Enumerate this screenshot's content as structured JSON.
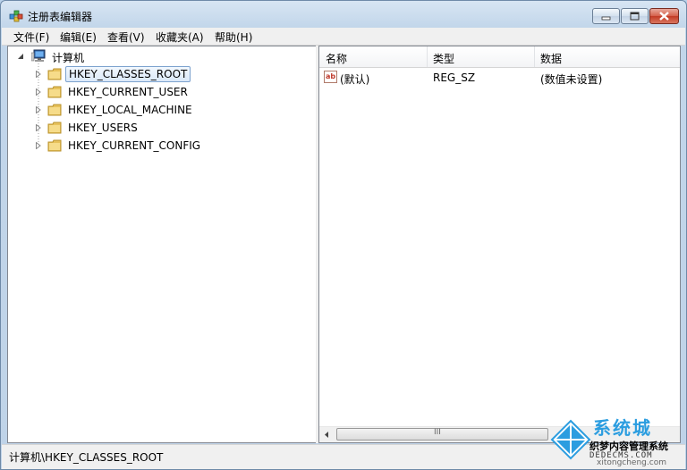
{
  "window": {
    "title": "注册表编辑器"
  },
  "menu": [
    {
      "label": "文件(F)"
    },
    {
      "label": "编辑(E)"
    },
    {
      "label": "查看(V)"
    },
    {
      "label": "收藏夹(A)"
    },
    {
      "label": "帮助(H)"
    }
  ],
  "tree": {
    "root_label": "计算机",
    "root_icon": "computer-icon",
    "folder_icon": "folder-icon",
    "nodes": [
      {
        "label": "HKEY_CLASSES_ROOT",
        "selected": true
      },
      {
        "label": "HKEY_CURRENT_USER"
      },
      {
        "label": "HKEY_LOCAL_MACHINE"
      },
      {
        "label": "HKEY_USERS"
      },
      {
        "label": "HKEY_CURRENT_CONFIG"
      }
    ]
  },
  "values_table": {
    "columns": [
      "名称",
      "类型",
      "数据"
    ],
    "rows": [
      {
        "icon": "string-value-icon",
        "icon_text": "ab",
        "name": "(默认)",
        "type": "REG_SZ",
        "data": "(数值未设置)"
      }
    ]
  },
  "scrollbar": {
    "grip": "III"
  },
  "status": {
    "path": "计算机\\HKEY_CLASSES_ROOT"
  },
  "watermark": {
    "line1": "系统城",
    "line2": "织梦内容管理系统",
    "line3": "DEDECMS.COM",
    "line4": "xitongcheng.com"
  },
  "colors": {
    "selection_border": "#7da2ce",
    "close_button": "#c23a24",
    "watermark_blue": "#2b9de0"
  }
}
